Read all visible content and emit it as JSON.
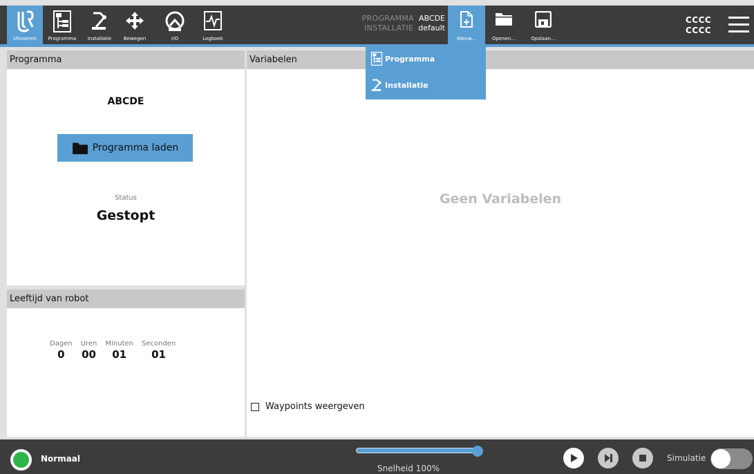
{
  "colors": {
    "accent": "#5a9fd4",
    "topbar": "#3c3c3c",
    "status_ok": "#2db54a"
  },
  "nav": {
    "items": [
      {
        "label": "Uitvoeren",
        "icon": "ur-logo-icon",
        "active": true
      },
      {
        "label": "Programma",
        "icon": "program-tree-icon"
      },
      {
        "label": "Installatie",
        "icon": "robot-arm-icon"
      },
      {
        "label": "Bewegen",
        "icon": "move-arrows-icon"
      },
      {
        "label": "I/O",
        "icon": "io-gauge-icon"
      },
      {
        "label": "Logboek",
        "icon": "log-chart-icon"
      }
    ]
  },
  "header": {
    "program_key": "PROGRAMMA",
    "program_value": "ABCDE",
    "installation_key": "INSTALLATIE",
    "installation_value": "default",
    "new_label": "Nieuw...",
    "open_label": "Openen...",
    "save_label": "Opslaan...",
    "user_line1": "CCCC",
    "user_line2": "CCCC"
  },
  "new_menu": {
    "items": [
      {
        "label": "Programma",
        "icon": "program-tree-icon"
      },
      {
        "label": "Installatie",
        "icon": "robot-arm-icon"
      }
    ]
  },
  "program_panel": {
    "title": "Programma",
    "program_name": "ABCDE",
    "load_button": "Programma laden",
    "status_label": "Status",
    "status_value": "Gestopt"
  },
  "age_panel": {
    "title": "Leeftijd van robot",
    "fields": [
      {
        "label": "Dagen",
        "value": "0"
      },
      {
        "label": "Uren",
        "value": "00"
      },
      {
        "label": "Minuten",
        "value": "01"
      },
      {
        "label": "Seconden",
        "value": "01"
      }
    ]
  },
  "variables_panel": {
    "title": "Variabelen",
    "empty_text": "Geen Variabelen",
    "waypoints_label": "Waypoints weergeven",
    "waypoints_checked": false
  },
  "footer": {
    "mode": "Normaal",
    "speed_label": "Snelheid 100%",
    "speed_value": 100,
    "simulation_label": "Simulatie",
    "simulation_on": false
  }
}
